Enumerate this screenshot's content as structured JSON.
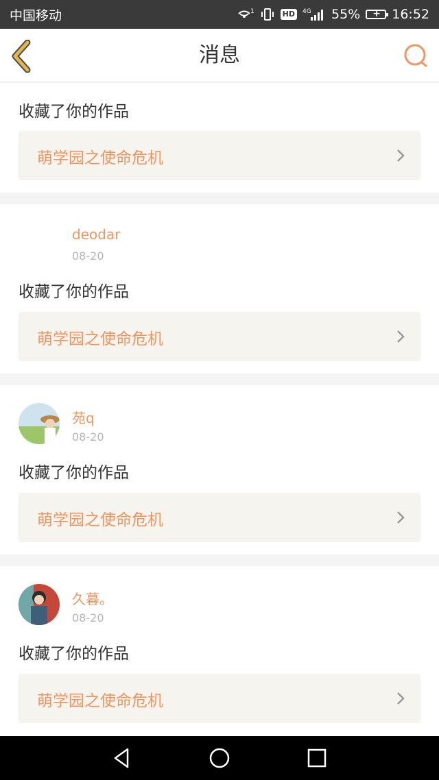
{
  "status_bar": {
    "carrier": "中国移动",
    "hd": "HD",
    "network": "4G",
    "battery": "55%",
    "time": "16:52"
  },
  "header": {
    "title": "消息"
  },
  "colors": {
    "accent": "#f0955f",
    "back_arrow": "#e2b64a",
    "work_bg": "#f5f4ee"
  },
  "messages": [
    {
      "action": "收藏了你的作品",
      "work": "萌学园之使命危机"
    },
    {
      "username": "deodar",
      "date": "08-20",
      "action": "收藏了你的作品",
      "work": "萌学园之使命危机"
    },
    {
      "username": "苑q",
      "date": "08-20",
      "action": "收藏了你的作品",
      "work": "萌学园之使命危机"
    },
    {
      "username": "久暮。",
      "date": "08-20",
      "action": "收藏了你的作品",
      "work": "萌学园之使命危机"
    }
  ]
}
